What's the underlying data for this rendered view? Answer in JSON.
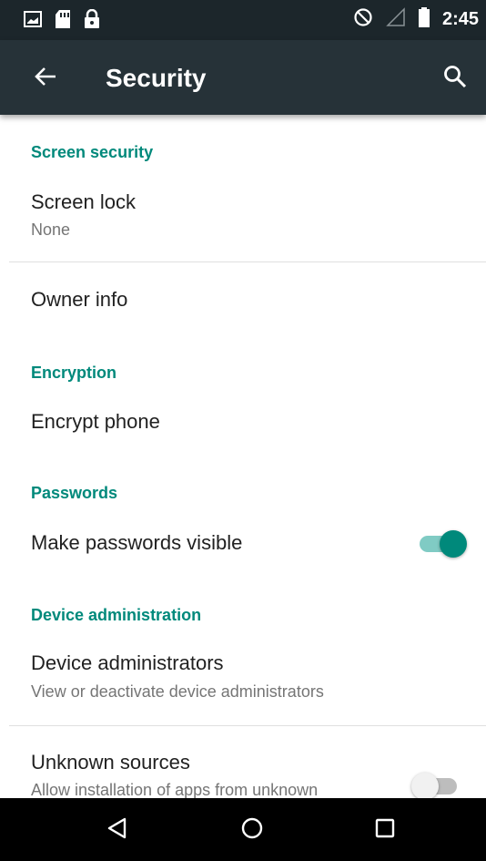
{
  "status_bar": {
    "time": "2:45",
    "icons": [
      "image-icon",
      "sd-card-icon",
      "lock-icon",
      "do-not-disturb-icon",
      "signal-icon",
      "battery-icon"
    ]
  },
  "app_bar": {
    "title": "Security",
    "back_icon": "arrow-back-icon",
    "search_icon": "search-icon"
  },
  "sections": {
    "screen_security": "Screen security",
    "encryption": "Encryption",
    "passwords": "Passwords",
    "device_administration": "Device administration"
  },
  "items": {
    "screen_lock": {
      "title": "Screen lock",
      "summary": "None"
    },
    "owner_info": {
      "title": "Owner info"
    },
    "encrypt_phone": {
      "title": "Encrypt phone"
    },
    "make_passwords_visible": {
      "title": "Make passwords visible",
      "enabled": true
    },
    "device_administrators": {
      "title": "Device administrators",
      "summary": "View or deactivate device administrators"
    },
    "unknown_sources": {
      "title": "Unknown sources",
      "summary": "Allow installation of apps from unknown",
      "enabled": false
    }
  },
  "colors": {
    "accent": "#00897b",
    "app_bar": "#263238",
    "status_bar": "#1c262b"
  },
  "nav_bar": {
    "icons": [
      "back-triangle-icon",
      "home-circle-icon",
      "recents-square-icon"
    ]
  }
}
